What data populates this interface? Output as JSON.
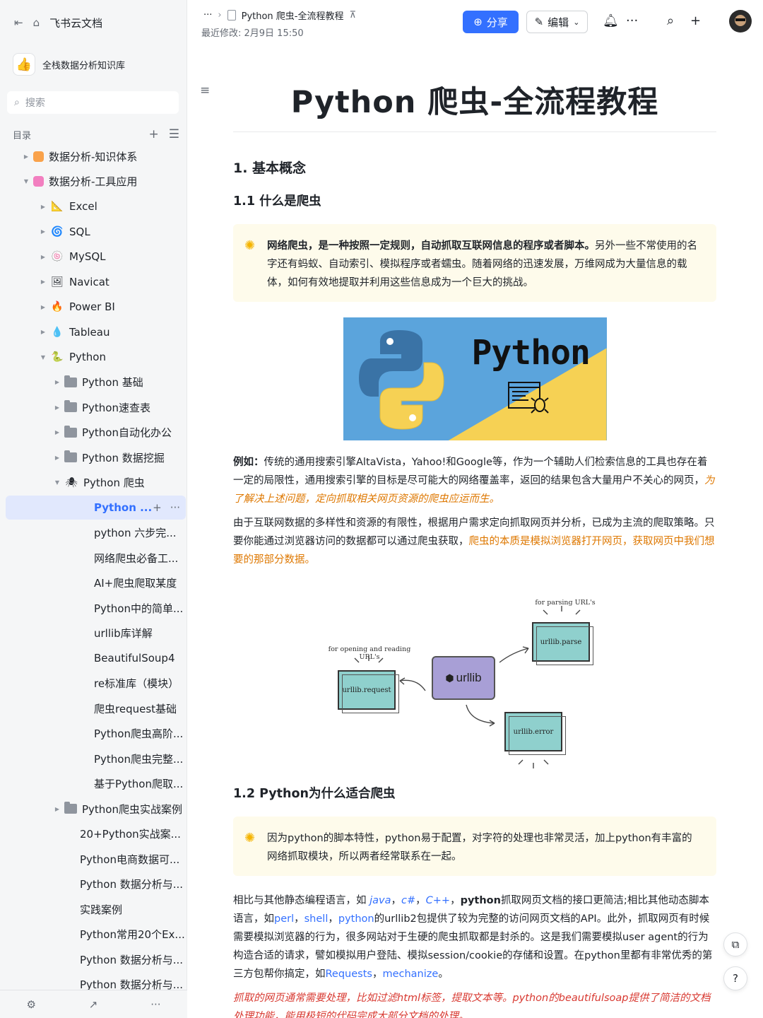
{
  "sidebar": {
    "app_name": "飞书云文档",
    "kb_name": "全栈数据分析知识库",
    "search_placeholder": "搜索",
    "toc_label": "目录",
    "tree": [
      {
        "label": "数据分析-知识体系",
        "icon": "book-icon"
      },
      {
        "label": "数据分析-工具应用",
        "icon": "book-icon"
      },
      {
        "label": "Excel",
        "icon": "ruler-icon"
      },
      {
        "label": "SQL",
        "icon": "swirl-icon"
      },
      {
        "label": "MySQL",
        "icon": "fish-icon"
      },
      {
        "label": "Navicat",
        "icon": "image-icon"
      },
      {
        "label": "Power BI",
        "icon": "fire-icon"
      },
      {
        "label": "Tableau",
        "icon": "drop-icon"
      },
      {
        "label": "Python",
        "icon": "snake-icon"
      },
      {
        "label": "Python 基础",
        "icon": "folder-icon"
      },
      {
        "label": "Python速查表",
        "icon": "folder-icon"
      },
      {
        "label": "Python自动化办公",
        "icon": "folder-icon"
      },
      {
        "label": "Python 数据挖掘",
        "icon": "folder-icon"
      },
      {
        "label": "Python 爬虫",
        "icon": "spider-icon"
      },
      {
        "label": "Python ...",
        "icon": "doc-icon"
      },
      {
        "label": "python 六步完...",
        "icon": "doc-icon"
      },
      {
        "label": "网络爬虫必备工...",
        "icon": "doc-icon"
      },
      {
        "label": "AI+爬虫爬取某度",
        "icon": "doc-icon"
      },
      {
        "label": "Python中的简单...",
        "icon": "doc-icon"
      },
      {
        "label": "urllib库详解",
        "icon": "doc-icon"
      },
      {
        "label": "BeautifulSoup4",
        "icon": "doc-icon"
      },
      {
        "label": "re标准库（模块）",
        "icon": "doc-icon"
      },
      {
        "label": "爬虫request基础",
        "icon": "doc-icon"
      },
      {
        "label": "Python爬虫高阶...",
        "icon": "doc-icon"
      },
      {
        "label": "Python爬虫完整...",
        "icon": "doc-icon"
      },
      {
        "label": "基于Python爬取...",
        "icon": "doc-icon"
      },
      {
        "label": "Python爬虫实战案例",
        "icon": "folder-icon"
      },
      {
        "label": "20+Python实战案...",
        "icon": "doc-icon"
      },
      {
        "label": "Python电商数据可...",
        "icon": "doc-icon"
      },
      {
        "label": "Python 数据分析与...",
        "icon": "doc-icon"
      },
      {
        "label": "实践案例",
        "icon": "doc-icon"
      },
      {
        "label": "Python常用20个Ex...",
        "icon": "doc-icon"
      },
      {
        "label": "Python 数据分析与...",
        "icon": "doc-icon"
      },
      {
        "label": "Python 数据分析与...",
        "icon": "doc-icon"
      }
    ]
  },
  "topbar": {
    "breadcrumb_more": "···",
    "doc_title": "Python 爬虫-全流程教程",
    "modified": "最近修改: 2月9日 15:50",
    "share_label": "分享",
    "edit_label": "编辑"
  },
  "doc": {
    "title": "Python 爬虫-全流程教程",
    "h1_1": "1. 基本概念",
    "h2_1": "1.1 什么是爬虫",
    "callout1_bold": "网络爬虫，是一种按照一定规则，自动抓取互联网信息的程序或者脚本。",
    "callout1_rest": "另外一些不常使用的名字还有蚂蚁、自动索引、模拟程序或者蠕虫。随着网络的迅速发展，万维网成为大量信息的载体，如何有效地提取并利用这些信息成为一个巨大的挑战。",
    "banner_word": "Python",
    "p1_bold": "例如：",
    "p1_text": "传统的通用搜索引擎AltaVista，Yahoo!和Google等，作为一个辅助人们检索信息的工具也存在着一定的局限性，通用搜索引擎的目标是尽可能大的网络覆盖率，返回的结果包含大量用户不关心的网页，",
    "p1_hl": "为了解决上述问题，定向抓取相关网页资源的爬虫应运而生。",
    "p2_text": "由于互联网数据的多样性和资源的有限性，根据用户需求定向抓取网页并分析，已成为主流的爬取策略。只要你能通过浏览器访问的数据都可以通过爬虫获取，",
    "p2_hl": "爬虫的本质是模拟浏览器打开网页，获取网页中我们想要的那部分数据。",
    "diagram": {
      "parse_caption": "for parsing URL's",
      "open_caption": "for opening and reading URL's",
      "core": "urllib",
      "request": "urllib.request",
      "parse": "urllib.parse",
      "error": "urllib.error"
    },
    "h2_2": "1.2 Python为什么适合爬虫",
    "callout2": "因为python的脚本特性，python易于配置，对字符的处理也非常灵活，加上python有丰富的网络抓取模块，所以两者经常联系在一起。",
    "p3_a": "相比与其他静态编程语言，如 ",
    "p3_java": "java",
    "p3_sep1": "，",
    "p3_c": "c#",
    "p3_sep2": "，",
    "p3_cpp": "C++",
    "p3_sep3": "，",
    "p3_python": "python",
    "p3_b": "抓取网页文档的接口更简洁;相比其他动态脚本语言，如",
    "p3_perl": "perl",
    "p3_sep4": "，",
    "p3_shell": "shell",
    "p3_sep5": "，",
    "p3_python2": "python",
    "p3_c2": "的urllib2包提供了较为完整的访问网页文档的API。此外，抓取网页有时候需要模拟浏览器的行为，很多网站对于生硬的爬虫抓取都是封杀的。这是我们需要模拟user agent的行为构造合适的请求，譬如模拟用户登陆、模拟session/cookie的存储和设置。在python里都有非常优秀的第三方包帮你搞定，如",
    "p3_requests": "Requests",
    "p3_sep6": "，",
    "p3_mechanize": "mechanize",
    "p3_end": "。",
    "p4_red": "抓取的网页通常需要处理，比如过滤html标签，提取文本等。python的beautifulsoap提供了简洁的文档处理功能，能用极短的代码完成大部分文档的处理。"
  },
  "colors": {
    "accent": "#3370ff",
    "highlight_orange": "#de7802",
    "highlight_red": "#d83931",
    "callout_bg": "#fefbeb"
  }
}
